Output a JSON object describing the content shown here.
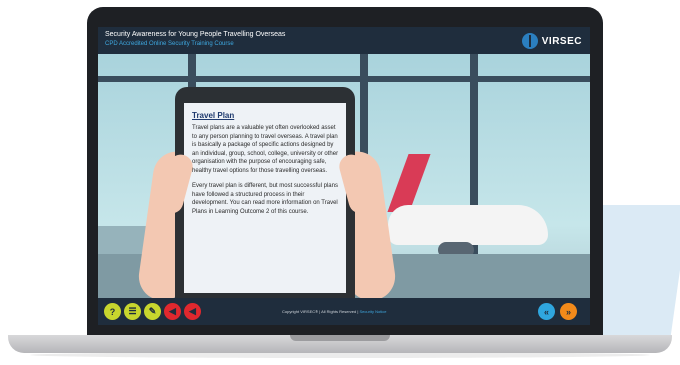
{
  "header": {
    "title": "Security Awareness for Young People Travelling Overseas",
    "subtitle": "CPD Accredited Online Security Training Course",
    "logo_text": "VIRSEC"
  },
  "tablet": {
    "heading": "Travel Plan",
    "paragraphs": [
      "Travel plans are a valuable yet often overlooked asset to any person planning to travel overseas. A travel plan is basically a package of specific actions designed by an individual, group, school, college, university or other organisation with the purpose of encouraging safe, healthy travel options for those travelling overseas.",
      "Every travel plan is different, but most successful plans have followed a structured process in their development. You can read more information on Travel Plans in Learning Outcome 2 of this course."
    ]
  },
  "footer": {
    "copyright": "Copyright VIRSEC® | All Rights Reserved |",
    "security_notice": "Security Notice",
    "controls_left": [
      {
        "icon": "help-icon",
        "glyph": "?",
        "color": "#c8d62e"
      },
      {
        "icon": "menu-list-icon",
        "glyph": "☰",
        "color": "#c8d62e"
      },
      {
        "icon": "pencil-icon",
        "glyph": "✎",
        "color": "#c8d62e"
      },
      {
        "icon": "audio-icon",
        "glyph": "◀",
        "color": "#e0282e"
      },
      {
        "icon": "mute-icon",
        "glyph": "◀",
        "color": "#e0282e"
      }
    ],
    "controls_right": [
      {
        "icon": "previous-icon",
        "glyph": "«",
        "color": "#2fa6df"
      },
      {
        "icon": "next-icon",
        "glyph": "»",
        "color": "#f28a1a"
      }
    ]
  }
}
